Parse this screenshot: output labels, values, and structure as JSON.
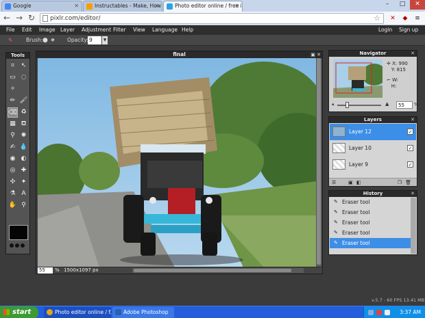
{
  "browser": {
    "tabs": [
      {
        "label": "Google",
        "fav": "#4285f4",
        "active": false
      },
      {
        "label": "Instructables - Make, How To",
        "fav": "#f4a000",
        "active": false
      },
      {
        "label": "Photo editor online / free ima",
        "fav": "#2ba3e5",
        "active": true
      }
    ],
    "url": "pixlr.com/editor/",
    "window_controls": [
      "–",
      "□",
      "✕"
    ]
  },
  "pixlr": {
    "menus": [
      "File",
      "Edit",
      "Image",
      "Layer",
      "Adjustment",
      "Filter",
      "View",
      "Language",
      "Help"
    ],
    "account": [
      "Login",
      "Sign up"
    ],
    "options": {
      "brush_label": "Brush:",
      "opacity_label": "Opacity:",
      "opacity_value": "9"
    },
    "tools_title": "Tools",
    "document": {
      "title": "final",
      "zoom": "55",
      "pct_sign": "%",
      "dimensions": "1500x1097 px"
    },
    "navigator": {
      "title": "Navigator",
      "x_label": "X:",
      "x": "990",
      "y_label": "Y:",
      "y": "815",
      "w_label": "W:",
      "h_label": "H:",
      "zoom": "55",
      "pct_sign": "%"
    },
    "layers": {
      "title": "Layers",
      "items": [
        {
          "name": "Layer 12",
          "selected": true
        },
        {
          "name": "Layer 10",
          "selected": false
        },
        {
          "name": "Layer 9",
          "selected": false
        }
      ]
    },
    "history": {
      "title": "History",
      "items": [
        {
          "name": "Eraser tool",
          "selected": false
        },
        {
          "name": "Eraser tool",
          "selected": false
        },
        {
          "name": "Eraser tool",
          "selected": false
        },
        {
          "name": "Eraser tool",
          "selected": false
        },
        {
          "name": "Eraser tool",
          "selected": true
        }
      ]
    },
    "status_right": "v.5.7 - 60 FPS 13.41 MB"
  },
  "taskbar": {
    "start": "start",
    "items": [
      {
        "label": "Photo editor online / f...",
        "color": "#e8a317"
      },
      {
        "label": "Adobe Photoshop",
        "color": "#2b5fb3"
      }
    ],
    "clock": "3:37 AM"
  },
  "colors": {
    "accent": "#3d8ee6",
    "panel_head": "#2a2a2a",
    "app_bg": "#3b3b3b"
  }
}
